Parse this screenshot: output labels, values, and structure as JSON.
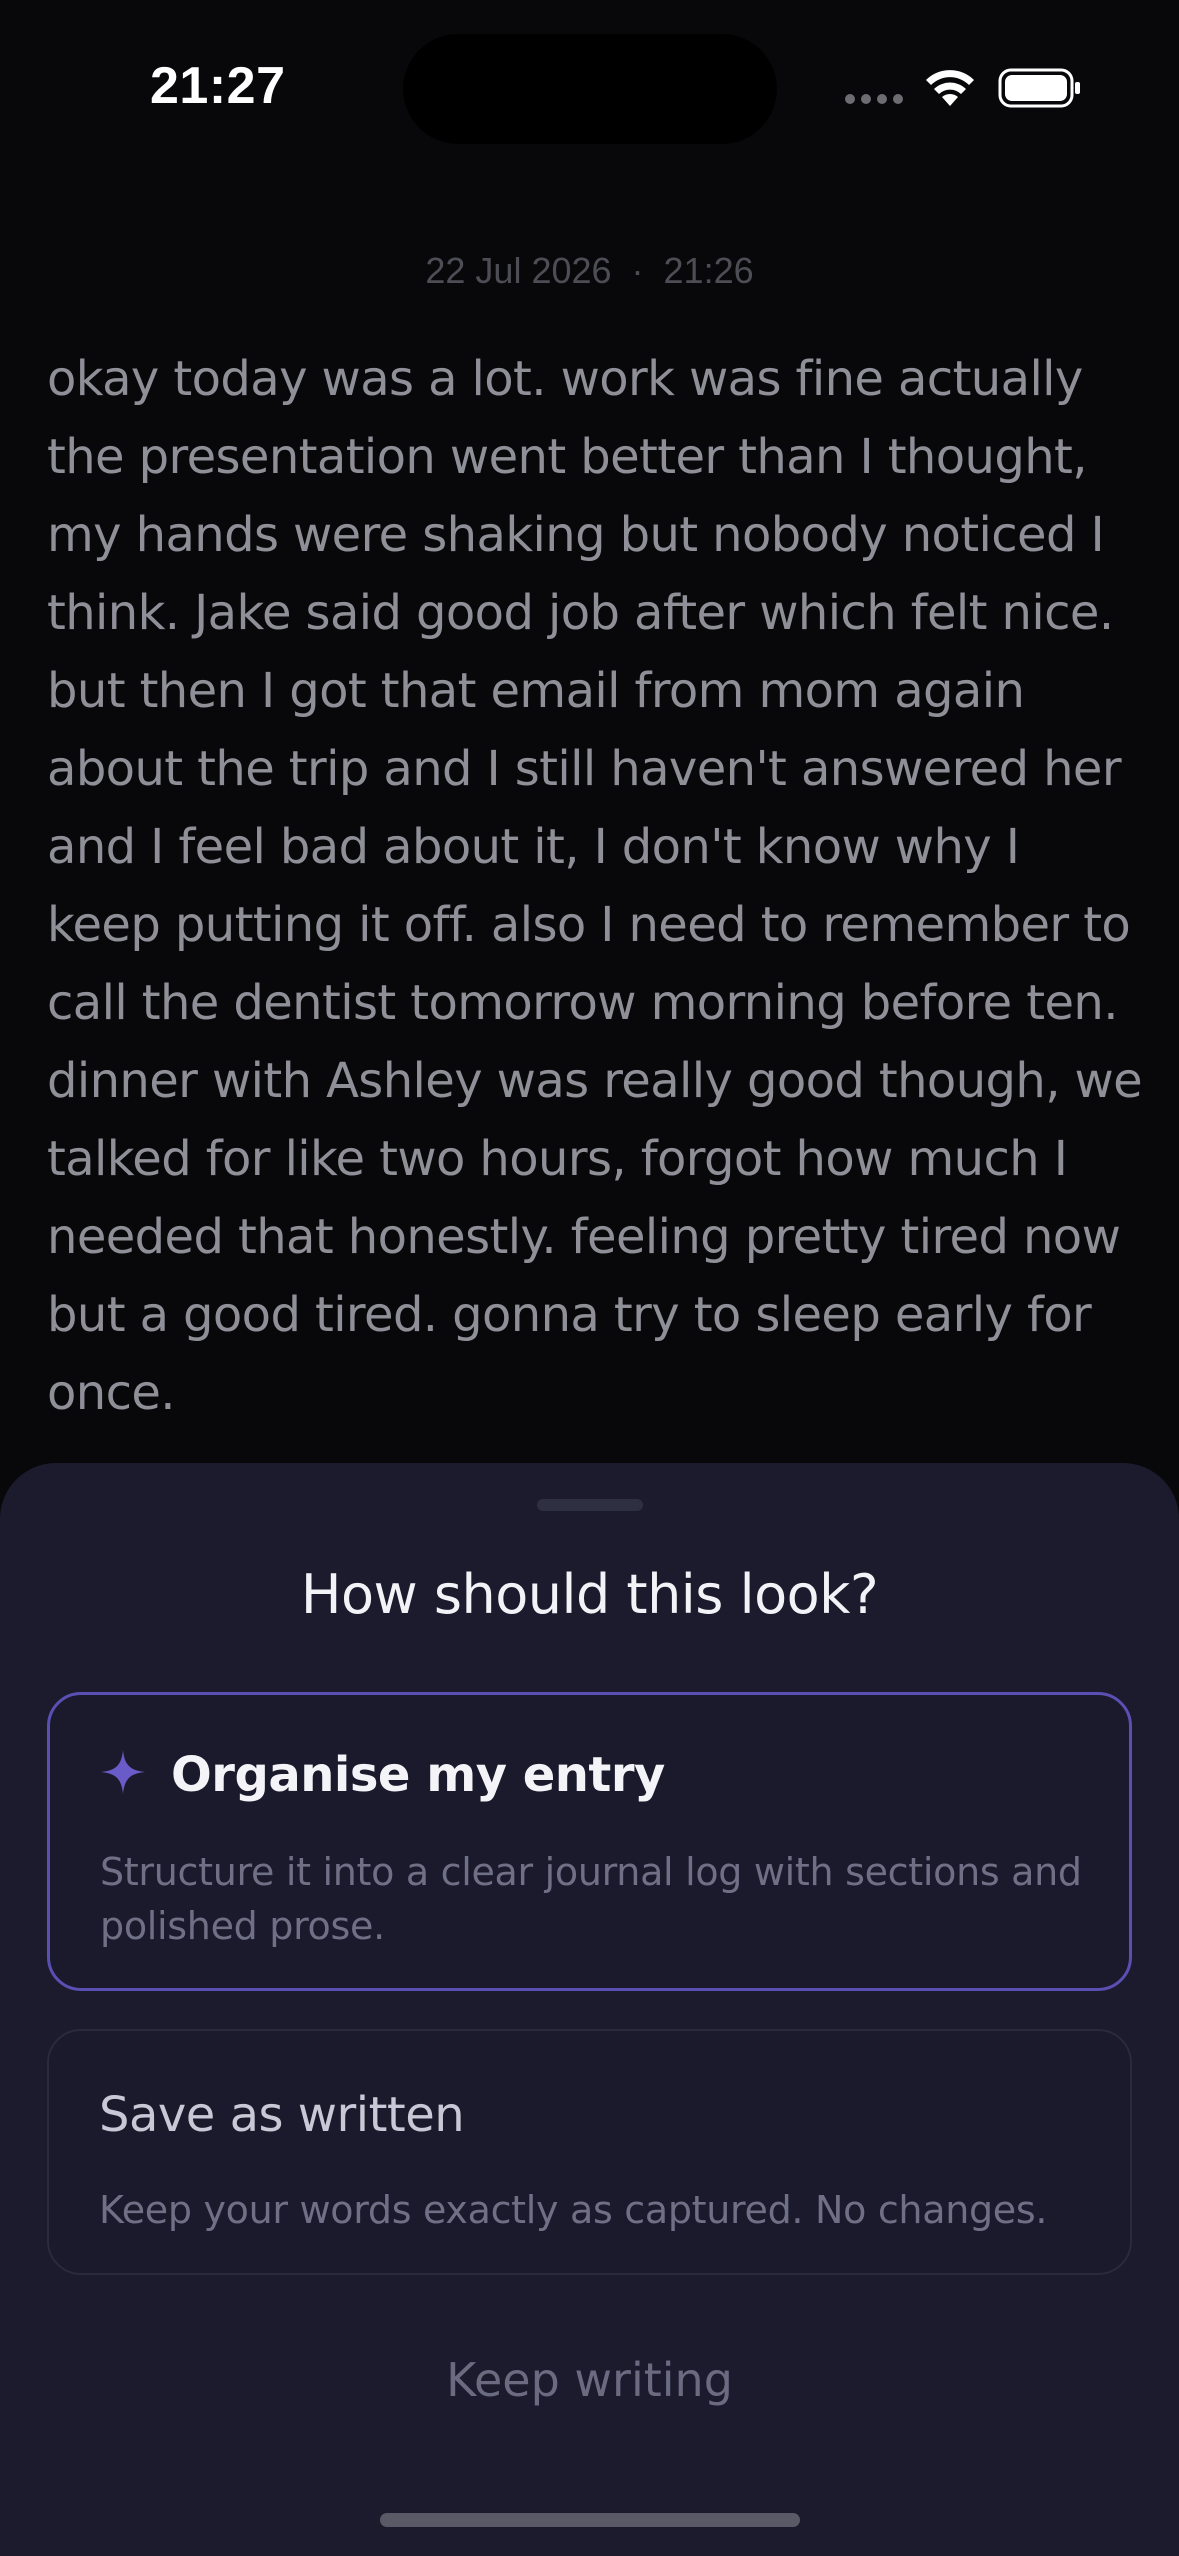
{
  "status_bar": {
    "time": "21:27"
  },
  "entry": {
    "date": "22 Jul 2026",
    "separator": "·",
    "time": "21:26",
    "text": "okay today was a lot. work was fine actually the presentation went better than I thought, my hands were shaking but nobody noticed I think. Jake said good job after which felt nice. but then I got that email from mom again about the trip and I still haven't answered her and I feel bad about it, I don't know why I keep putting it off. also I need to remember to call the dentist tomorrow morning before ten. dinner with Ashley was really good though, we talked for like two hours, forgot how much I needed that honestly. feeling pretty tired now but a good tired. gonna try to sleep early for once."
  },
  "sheet": {
    "title": "How should this look?",
    "options": [
      {
        "icon": "sparkle-icon",
        "label": "Organise my entry",
        "description": "Structure it into a clear journal log with sections and polished prose.",
        "selected": true
      },
      {
        "label": "Save as written",
        "description": "Keep your words exactly as captured. No changes.",
        "selected": false
      }
    ],
    "secondary_action": "Keep writing"
  },
  "colors": {
    "background": "#08080b",
    "sheet": "#1b1b2d",
    "accent": "#5a4fb2",
    "sparkle": "#6a5cc8"
  }
}
